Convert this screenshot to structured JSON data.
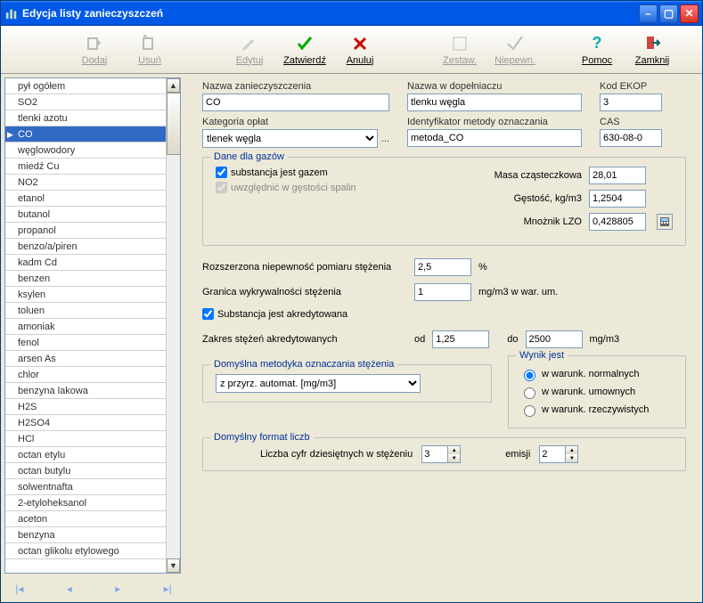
{
  "window": {
    "title": "Edycja listy zanieczyszczeń"
  },
  "toolbar": {
    "dodaj": "Dodaj",
    "usun": "Usuń",
    "edytuj": "Edytuj",
    "zatwierdz": "Zatwierdź",
    "anuluj": "Anuluj",
    "zestaw": "Zestaw.",
    "niepewn": "Niepewn.",
    "pomoc": "Pomoc",
    "zamknij": "Zamknij"
  },
  "list": {
    "items": [
      "pył ogółem",
      "SO2",
      "tlenki azotu",
      "CO",
      "węglowodory",
      "miedź Cu",
      "NO2",
      "etanol",
      "butanol",
      "propanol",
      "benzo/a/piren",
      "kadm Cd",
      "benzen",
      "ksylen",
      "toluen",
      "amoniak",
      "fenol",
      "arsen As",
      "chlor",
      "benzyna lakowa",
      "H2S",
      "H2SO4",
      "HCl",
      "octan etylu",
      "octan butylu",
      "solwentnafta",
      "2-etyloheksanol",
      "aceton",
      "benzyna",
      "octan glikolu etylowego"
    ],
    "selected_index": 3
  },
  "form": {
    "labels": {
      "nazwa": "Nazwa zanieczyszczenia",
      "nazwa_dop": "Nazwa w dopełniaczu",
      "kod_ekop": "Kod EKOP",
      "kategoria": "Kategoria opłat",
      "identyfikator": "Identyfikator metody oznaczania",
      "cas": "CAS"
    },
    "values": {
      "nazwa": "CO",
      "nazwa_dop": "tlenku węgla",
      "kod_ekop": "3",
      "kategoria": "tlenek węgla",
      "identyfikator": "metoda_CO",
      "cas": "630-08-0"
    }
  },
  "gas": {
    "title": "Dane dla gazów",
    "chk_jest_gazem": "substancja jest gazem",
    "chk_gest_spalin": "uwzględnić w gęstości spalin",
    "labels": {
      "masa": "Masa cząsteczkowa",
      "gestosc": "Gęstość, kg/m3",
      "mnoznik": "Mnożnik LZO"
    },
    "values": {
      "masa": "28,01",
      "gestosc": "1,2504",
      "mnoznik": "0,428805"
    }
  },
  "accuracy": {
    "labels": {
      "rozszerzona": "Rozszerzona niepewność pomiaru stężenia",
      "granica": "Granica wykrywalności stężenia",
      "akredytowana": "Substancja jest akredytowana",
      "zakres": "Zakres stężeń akredytowanych",
      "od": "od",
      "do": "do",
      "unit_pct": "%",
      "unit_mg_war": "mg/m3 w war. um.",
      "unit_mg": "mg/m3"
    },
    "values": {
      "rozszerzona": "2,5",
      "granica": "1",
      "od": "1,25",
      "do": "2500"
    }
  },
  "method": {
    "title": "Domyślna metodyka oznaczania stężenia",
    "value": "z przyrz. automat. [mg/m3]"
  },
  "wynik": {
    "title": "Wynik jest",
    "opts": [
      "w warunk. normalnych",
      "w warunk. umownych",
      "w warunk. rzeczywistych"
    ],
    "selected": 0
  },
  "format": {
    "title": "Domyślny format liczb",
    "label": "Liczba cyfr dziesiętnych  w stężeniu",
    "stezenie": "3",
    "emisji_label": "emisji",
    "emisji": "2"
  }
}
